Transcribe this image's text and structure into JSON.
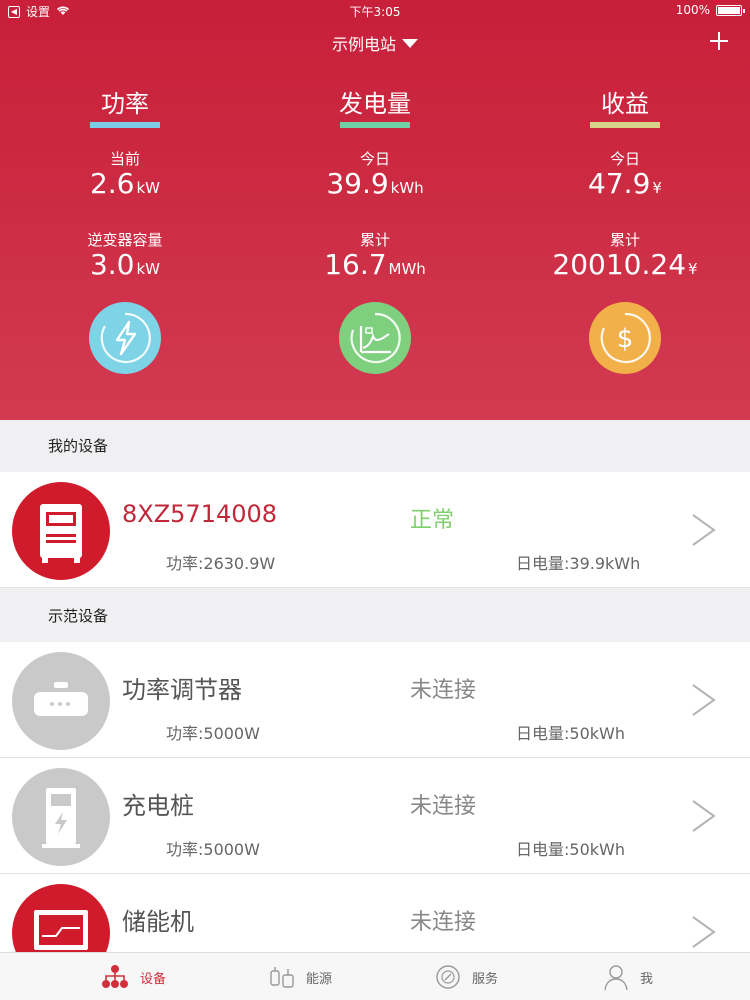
{
  "status_bar": {
    "back_label": "设置",
    "time": "下午3:05",
    "battery": "100%"
  },
  "nav": {
    "title": "示例电站",
    "add_icon": "plus-icon"
  },
  "summary": {
    "columns": [
      {
        "title": "功率",
        "underline_color": "#7ecbe6",
        "stat1_label": "当前",
        "stat1_value": "2.6",
        "stat1_unit": "kW",
        "stat2_label": "逆变器容量",
        "stat2_value": "3.0",
        "stat2_unit": "kW",
        "icon": "lightning-icon",
        "icon_color": "#7fd3e6"
      },
      {
        "title": "发电量",
        "underline_color": "#6fd0a6",
        "stat1_label": "今日",
        "stat1_value": "39.9",
        "stat1_unit": "kWh",
        "stat2_label": "累计",
        "stat2_value": "16.7",
        "stat2_unit": "MWh",
        "icon": "chart-icon",
        "icon_color": "#7ed07f"
      },
      {
        "title": "收益",
        "underline_color": "#d6d48a",
        "stat1_label": "今日",
        "stat1_value": "47.9",
        "stat1_unit": "¥",
        "stat2_label": "累计",
        "stat2_value": "20010.24",
        "stat2_unit": "¥",
        "icon": "dollar-icon",
        "icon_color": "#f2b04a"
      }
    ]
  },
  "my_devices": {
    "header": "我的设备",
    "items": [
      {
        "name": "8XZ5714008",
        "status": "正常",
        "power": "功率:2630.9W",
        "energy": "日电量:39.9kWh",
        "icon": "inverter-icon",
        "avatar_color": "#cf1b2b",
        "name_color": "#c0283a",
        "status_color": "#7fd06c"
      }
    ]
  },
  "demo_devices": {
    "header": "示范设备",
    "items": [
      {
        "name": "功率调节器",
        "status": "未连接",
        "power": "功率:5000W",
        "energy": "日电量:50kWh",
        "icon": "router-icon",
        "avatar_color": "#c9c9c9"
      },
      {
        "name": "充电桩",
        "status": "未连接",
        "power": "功率:5000W",
        "energy": "日电量:50kWh",
        "icon": "charger-icon",
        "avatar_color": "#c9c9c9"
      },
      {
        "name": "储能机",
        "status": "未连接",
        "power": "",
        "energy": "",
        "icon": "storage-icon",
        "avatar_color": "#cf1b2b"
      }
    ]
  },
  "tab_bar": {
    "tabs": [
      {
        "label": "设备",
        "icon": "devices-icon",
        "active": true
      },
      {
        "label": "能源",
        "icon": "energy-icon",
        "active": false
      },
      {
        "label": "服务",
        "icon": "service-icon",
        "active": false
      },
      {
        "label": "我",
        "icon": "person-icon",
        "active": false
      }
    ],
    "active_color": "#d0303c"
  }
}
